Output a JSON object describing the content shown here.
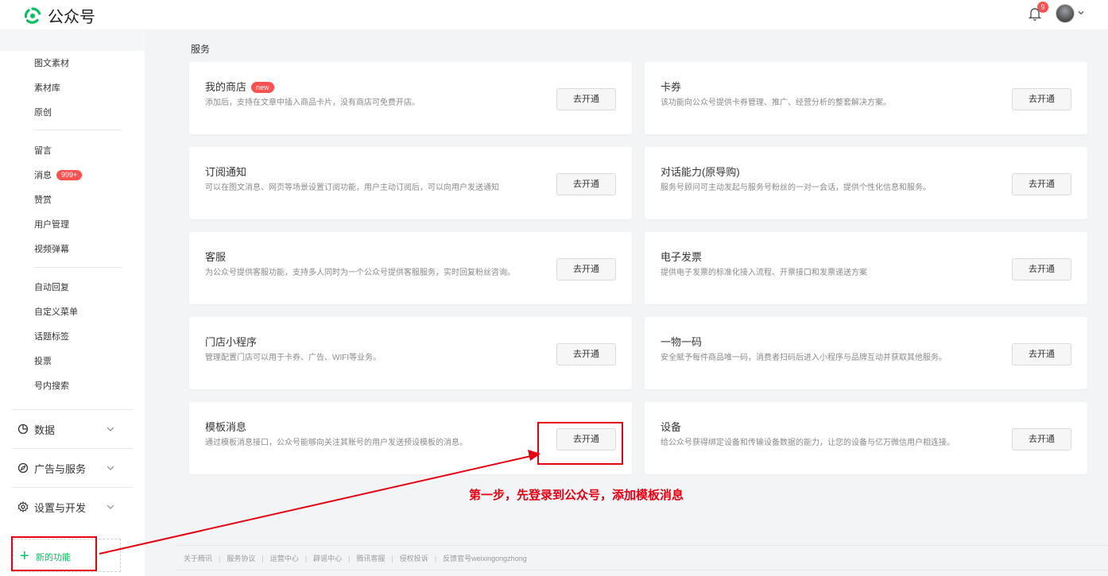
{
  "header": {
    "app_title": "公众号",
    "notification_count": "9",
    "logo_icon": "wechat-mp-logo-icon",
    "accent": "#07c160",
    "badge_color": "#fa5151"
  },
  "sidebar": {
    "content_items": [
      {
        "label": "图文素材"
      },
      {
        "label": "素材库"
      },
      {
        "label": "原创"
      }
    ],
    "interaction_items": [
      {
        "label": "留言"
      },
      {
        "label": "消息",
        "badge": "999+"
      },
      {
        "label": "赞赏"
      },
      {
        "label": "用户管理"
      },
      {
        "label": "视频弹幕"
      }
    ],
    "function_items": [
      {
        "label": "自动回复"
      },
      {
        "label": "自定义菜单"
      },
      {
        "label": "话题标签"
      },
      {
        "label": "投票"
      },
      {
        "label": "号内搜索"
      }
    ],
    "groups": [
      {
        "label": "数据",
        "icon": "pie-chart-icon"
      },
      {
        "label": "广告与服务",
        "icon": "compass-icon"
      },
      {
        "label": "设置与开发",
        "icon": "gear-icon"
      }
    ],
    "new_feature": {
      "label": "新的功能",
      "icon": "plus-icon"
    }
  },
  "main": {
    "section_title": "服务",
    "cards": [
      {
        "title": "我的商店",
        "tag": "new",
        "desc": "添加后，支持在文章中插入商品卡片，没有商店可免费开店。",
        "button": "去开通"
      },
      {
        "title": "卡券",
        "desc": "该功能向公众号提供卡券管理、推广、经营分析的整套解决方案。",
        "button": "去开通"
      },
      {
        "title": "订阅通知",
        "desc": "可以在图文消息、网页等场景设置订阅功能，用户主动订阅后，可以向用户发送通知",
        "button": "去开通"
      },
      {
        "title": "对话能力(原导购)",
        "desc": "服务号顾问可主动发起与服务号粉丝的一对一会话，提供个性化信息和服务。",
        "button": "去开通"
      },
      {
        "title": "客服",
        "desc": "为公众号提供客服功能，支持多人同时为一个公众号提供客服服务，实时回复粉丝咨询。",
        "button": "去开通"
      },
      {
        "title": "电子发票",
        "desc": "提供电子发票的标准化接入流程、开票接口和发票递送方案",
        "button": "去开通"
      },
      {
        "title": "门店小程序",
        "desc": "管理配置门店可以用于卡券、广告、WIFI等业务。",
        "button": "去开通"
      },
      {
        "title": "一物一码",
        "desc": "安全赋予每件商品唯一码，消费者扫码后进入小程序与品牌互动并获取其他服务。",
        "button": "去开通"
      },
      {
        "title": "模板消息",
        "desc": "通过模板消息接口，公众号能够向关注其账号的用户发送预设模板的消息。",
        "button": "去开通"
      },
      {
        "title": "设备",
        "desc": "给公众号获得绑定设备和传输设备数据的能力，让您的设备与亿万微信用户相连接。",
        "button": "去开通"
      }
    ]
  },
  "annotation": {
    "text": "第一步，先登录到公众号，添加模板消息",
    "color": "#e60012"
  },
  "footer": {
    "links": [
      "关于腾讯",
      "服务协议",
      "运营中心",
      "辟谣中心",
      "腾讯客服",
      "侵权投诉",
      "反馈官号weixingongzhong"
    ]
  }
}
